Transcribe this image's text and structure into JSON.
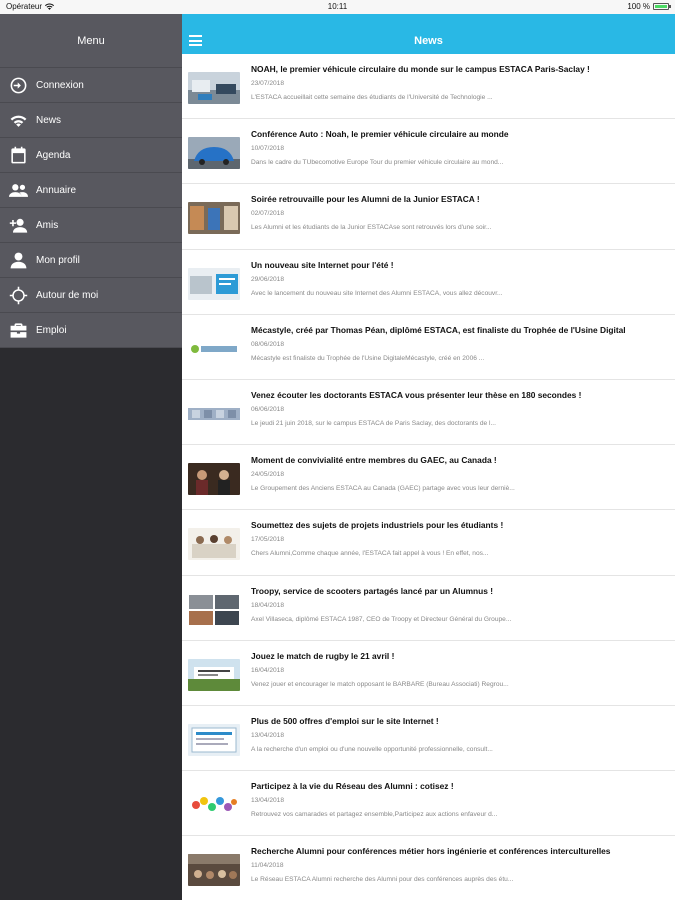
{
  "status_bar": {
    "carrier": "Opérateur",
    "time": "10:11",
    "battery": "100 %"
  },
  "sidebar": {
    "title": "Menu",
    "items": [
      {
        "label": "Connexion",
        "icon": "login-icon"
      },
      {
        "label": "News",
        "icon": "wifi-icon"
      },
      {
        "label": "Agenda",
        "icon": "calendar-icon"
      },
      {
        "label": "Annuaire",
        "icon": "group-icon"
      },
      {
        "label": "Amis",
        "icon": "add-friend-icon"
      },
      {
        "label": "Mon profil",
        "icon": "user-icon"
      },
      {
        "label": "Autour de moi",
        "icon": "crosshair-icon"
      },
      {
        "label": "Emploi",
        "icon": "briefcase-icon"
      }
    ]
  },
  "header": {
    "title": "News"
  },
  "news": [
    {
      "title": "NOAH, le premier véhicule circulaire du monde sur le campus ESTACA Paris-Saclay !",
      "date": "23/07/2018",
      "excerpt": "L'ESTACA accueillait cette semaine des étudiants de l'Université de Technologie ..."
    },
    {
      "title": "Conférence Auto : Noah, le premier véhicule circulaire au monde",
      "date": "10/07/2018",
      "excerpt": "Dans le cadre du TUbecomotive Europe Tour du premier véhicule circulaire au mond..."
    },
    {
      "title": "Soirée retrouvaille pour les Alumni de la Junior ESTACA !",
      "date": "02/07/2018",
      "excerpt": "Les Alumni et les étudiants de la Junior ESTACAse sont retrouvés lors d'une soir..."
    },
    {
      "title": "Un nouveau site Internet pour l'été !",
      "date": "29/06/2018",
      "excerpt": "Avec le lancement du nouveau site Internet des Alumni ESTACA, vous allez découvr..."
    },
    {
      "title": "Mécastyle, créé par Thomas Péan, diplômé ESTACA, est finaliste du Trophée de l'Usine Digital",
      "date": "08/06/2018",
      "excerpt": "Mécastyle est finaliste du Trophée de l'Usine DigitaleMécastyle, créé en 2006 ..."
    },
    {
      "title": "Venez écouter les doctorants ESTACA vous présenter leur thèse en 180 secondes !",
      "date": "06/06/2018",
      "excerpt": "Le jeudi 21 juin 2018, sur le campus ESTACA de Paris Saclay, des doctorants de l..."
    },
    {
      "title": "Moment de convivialité entre membres du GAEC, au Canada !",
      "date": "24/05/2018",
      "excerpt": "Le Groupement des Anciens ESTACA au Canada (GAEC) partage avec vous leur derniè..."
    },
    {
      "title": "Soumettez des sujets de projets industriels pour les étudiants !",
      "date": "17/05/2018",
      "excerpt": "Chers Alumni,Comme chaque année, l'ESTACA fait appel à vous ! En effet, nos..."
    },
    {
      "title": "Troopy, service de scooters partagés lancé par un Alumnus !",
      "date": "18/04/2018",
      "excerpt": "Axel Villaseca, diplômé ESTACA 1987, CEO de Troopy et Directeur Général du Groupe..."
    },
    {
      "title": "Jouez le match de rugby le 21 avril !",
      "date": "16/04/2018",
      "excerpt": "Venez jouer et encourager le match opposant le BARBARE (Bureau Associati) Regrou..."
    },
    {
      "title": "Plus de 500 offres d'emploi sur le site Internet !",
      "date": "13/04/2018",
      "excerpt": "A la recherche d'un emploi ou d'une nouvelle opportunité professionnelle, consult..."
    },
    {
      "title": "Participez à la vie du Réseau des Alumni : cotisez !",
      "date": "13/04/2018",
      "excerpt": "Retrouvez vos camarades et partagez ensemble,Participez aux actions enfaveur d..."
    },
    {
      "title": "Recherche Alumni pour conférences métier hors ingénierie et conférences interculturelles",
      "date": "11/04/2018",
      "excerpt": "Le Réseau ESTACA Alumni recherche des Alumni pour des conférences auprès des étu..."
    }
  ]
}
